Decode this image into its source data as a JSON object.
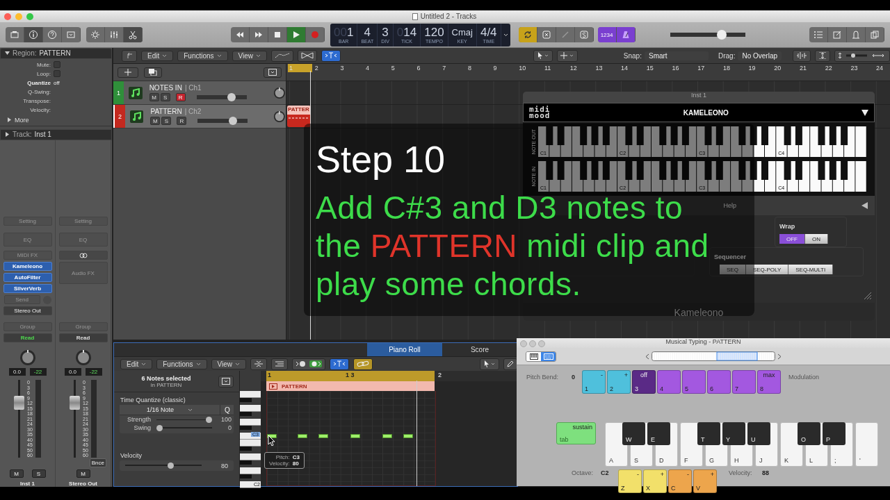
{
  "window": {
    "title": "Untitled 2 - Tracks"
  },
  "toolbar": {
    "cycle": true,
    "count_in": "1234",
    "master": {
      "level": 0.72
    }
  },
  "lcd": [
    {
      "prefix": "00",
      "value": "1",
      "label": "BAR"
    },
    {
      "value": "4",
      "label": "BEAT"
    },
    {
      "value": "3",
      "label": "DIV"
    },
    {
      "prefix": "0",
      "value": "14",
      "label": "TICK"
    },
    {
      "value": "120",
      "label": "TEMPO"
    },
    {
      "value": "Cmaj",
      "label": "KEY"
    },
    {
      "value": "4/4",
      "label": "TIME"
    }
  ],
  "inspector": {
    "region": {
      "label": "Region:",
      "name": "PATTERN",
      "expanded": true
    },
    "rows": [
      {
        "label": "Mute:",
        "kind": "check",
        "checked": false
      },
      {
        "label": "Loop:",
        "kind": "check",
        "checked": false
      },
      {
        "label": "Quantize",
        "kind": "select",
        "value": "off"
      },
      {
        "label": "Q-Swing:",
        "kind": "text"
      },
      {
        "label": "Transpose:",
        "kind": "select"
      },
      {
        "label": "Velocity:",
        "kind": "text"
      }
    ],
    "more": "More",
    "track": {
      "label": "Track:",
      "name": "Inst 1",
      "expanded": false
    }
  },
  "strips": [
    {
      "slots": [
        {
          "kind": "button",
          "label": "Setting"
        },
        {
          "kind": "tall",
          "label": "EQ"
        },
        {
          "kind": "button",
          "label": "MIDI FX"
        },
        {
          "kind": "plugin",
          "label": "Kameleono"
        },
        {
          "kind": "plugin",
          "label": "AutoFilter"
        },
        {
          "kind": "plugin",
          "label": "SilverVerb"
        },
        {
          "kind": "send",
          "label": "Send"
        },
        {
          "kind": "output",
          "label": "Stereo Out"
        }
      ],
      "group": "Group",
      "automation": {
        "label": "Read",
        "active": true
      },
      "volume": "0.0",
      "peak": "-22",
      "fader": {
        "level": 0.75
      },
      "scale": [
        "0",
        "3",
        "6",
        "9",
        "12",
        "15",
        "18",
        "21",
        "24",
        "30",
        "35",
        "40",
        "45",
        "50",
        "60"
      ],
      "buttons": [
        "M",
        "S"
      ],
      "name": "Inst 1"
    },
    {
      "slots": [
        {
          "kind": "button",
          "label": "Setting"
        },
        {
          "kind": "tall",
          "label": "EQ"
        },
        {
          "kind": "link"
        },
        {
          "kind": "fx",
          "label": "Audio FX"
        }
      ],
      "group": "Group",
      "automation": {
        "label": "Read",
        "active": false
      },
      "volume": "0.0",
      "peak": "-22",
      "fader": {
        "level": 0.75
      },
      "scale": [
        "0",
        "3",
        "6",
        "9",
        "12",
        "15",
        "18",
        "21",
        "24",
        "30",
        "35",
        "40",
        "45",
        "50",
        "60"
      ],
      "bounce": "Bnce",
      "buttons": [
        "M"
      ],
      "name": "Stereo Out"
    }
  ],
  "tracks": {
    "menus": [
      "Edit",
      "Functions",
      "View"
    ],
    "snap": {
      "label": "Snap:",
      "value": "Smart"
    },
    "drag": {
      "label": "Drag:",
      "value": "No Overlap"
    },
    "ruler": [
      "1",
      "2",
      "3",
      "4",
      "5",
      "6",
      "7",
      "8",
      "9",
      "10",
      "11",
      "12",
      "13",
      "14",
      "15",
      "16",
      "17",
      "18",
      "19",
      "20",
      "21",
      "22",
      "23",
      "24"
    ],
    "list": [
      {
        "number": "1",
        "name": "NOTES IN",
        "channel": "| Ch1",
        "color": "#2f8f3a",
        "selected": false,
        "buttons": [
          {
            "label": "M",
            "kind": "mute",
            "on": false
          },
          {
            "label": "S",
            "kind": "solo",
            "on": false
          },
          {
            "label": "R",
            "kind": "record",
            "on": true
          }
        ],
        "volume": {
          "level": 0.74
        }
      },
      {
        "number": "2",
        "name": "PATTERN",
        "channel": "| Ch2",
        "color": "#c4291f",
        "selected": true,
        "buttons": [
          {
            "label": "M",
            "kind": "mute",
            "on": false
          },
          {
            "label": "S",
            "kind": "solo",
            "on": false
          },
          {
            "label": "R",
            "kind": "record",
            "on": false
          }
        ],
        "volume": {
          "level": 0.74
        },
        "region": "PATTER"
      }
    ]
  },
  "plugin": {
    "title": "Inst 1",
    "logo": [
      "midi",
      "mood"
    ],
    "preset": "KAMELEONO",
    "keyboards": [
      {
        "label": "NOTE OUT",
        "octaves": [
          "C1",
          "C2",
          "C3",
          "C4"
        ]
      },
      {
        "label": "NOTE IN",
        "octaves": [
          "C1",
          "C2",
          "C3",
          "C4"
        ]
      }
    ],
    "help": "Help",
    "wrap": {
      "title": "Wrap",
      "options": [
        {
          "label": "OFF",
          "selected": true
        },
        {
          "label": "ON",
          "selected": false
        }
      ]
    },
    "sequencer": {
      "title": "Sequencer",
      "options": [
        {
          "label": "SEQ",
          "selected": false
        },
        {
          "label": "SEQ-POLY",
          "selected": false
        },
        {
          "label": "SEQ-MULTI",
          "selected": false
        }
      ]
    },
    "footer": "Kameleono"
  },
  "overlay": {
    "step": "Step 10",
    "instruction": [
      {
        "kind": "plain",
        "text": "Add C#3 and D3 notes to the "
      },
      {
        "kind": "highlight",
        "text": "PATTERN"
      },
      {
        "kind": "plain",
        "text": " midi clip and play some chords."
      }
    ]
  },
  "editor": {
    "tabs": [
      {
        "label": "Piano Roll",
        "selected": true
      },
      {
        "label": "Score",
        "selected": false
      }
    ],
    "menus": [
      "Edit",
      "Functions",
      "View"
    ],
    "selection": "6 Notes selected",
    "selection_sub": "in PATTERN",
    "quantize": {
      "title": "Time Quantize (classic)",
      "value": "1/16 Note",
      "q": "Q",
      "strength": {
        "label": "Strength",
        "value": "100",
        "level": 1
      },
      "swing": {
        "label": "Swing",
        "value": "0",
        "level": 0
      }
    },
    "velocity": {
      "label": "Velocity",
      "value": "80",
      "level": 0.6
    },
    "ruler": [
      "1",
      "1 3",
      "2"
    ],
    "region": "PATTERN",
    "keys": [
      "C3",
      "C2"
    ],
    "tooltip": {
      "pitch_label": "Pitch:",
      "pitch": "C3",
      "velocity_label": "Velocity:",
      "velocity": "80"
    }
  },
  "typing": {
    "title": "Musical Typing - PATTERN",
    "pitch_label": "Pitch Bend:",
    "pitch": "0",
    "modulation": "Modulation",
    "number_keys": [
      {
        "top": "-",
        "key": "1",
        "color": "#4fc0dc"
      },
      {
        "top": "+",
        "key": "2",
        "color": "#4fc0dc"
      },
      {
        "top": "off",
        "key": "3",
        "color": "#5a2a86"
      },
      {
        "key": "4",
        "color": "#a358e0"
      },
      {
        "key": "5",
        "color": "#a358e0"
      },
      {
        "key": "6",
        "color": "#a358e0"
      },
      {
        "key": "7",
        "color": "#a358e0"
      },
      {
        "top": "max",
        "key": "8",
        "color": "#a358e0"
      }
    ],
    "sustain": {
      "top": "sustain",
      "key": "tab"
    },
    "keys": [
      {
        "label": "A",
        "black": "W"
      },
      {
        "label": "S",
        "black": "E"
      },
      {
        "label": "D"
      },
      {
        "label": "F",
        "black": "T"
      },
      {
        "label": "G",
        "black": "Y"
      },
      {
        "label": "H",
        "black": "U"
      },
      {
        "label": "J"
      },
      {
        "label": "K",
        "black": "O"
      },
      {
        "label": "L",
        "black": "P"
      },
      {
        "label": ";"
      },
      {
        "label": "'"
      }
    ],
    "octave_label": "Octave:",
    "octave": "C2",
    "octave_keys": [
      {
        "top": "-",
        "key": "Z",
        "color": "#f2e06a"
      },
      {
        "top": "+",
        "key": "X",
        "color": "#f2e06a"
      },
      {
        "top": "-",
        "key": "C",
        "color": "#eda54c"
      },
      {
        "top": "+",
        "key": "V",
        "color": "#eda54c"
      }
    ],
    "velocity_label": "Velocity:",
    "velocity": "88"
  }
}
